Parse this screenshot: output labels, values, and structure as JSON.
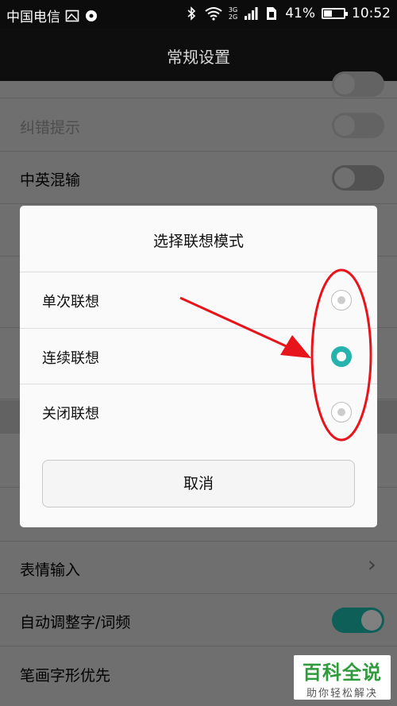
{
  "status_bar": {
    "carrier": "中国电信",
    "network_3g": "3G",
    "network_2g": "2G",
    "battery_pct": "41%",
    "battery_level": 0.41,
    "time": "10:52"
  },
  "header": {
    "title": "常规设置"
  },
  "settings": {
    "spell_hint": "纠错提示",
    "cn_en_mix": "中英混输",
    "emoji_input": "表情输入",
    "auto_adjust": "自动调整字/词频",
    "stroke_priority": "笔画字形优先"
  },
  "dialog": {
    "title": "选择联想模式",
    "options": [
      {
        "label": "单次联想",
        "selected": false
      },
      {
        "label": "连续联想",
        "selected": true
      },
      {
        "label": "关闭联想",
        "selected": false
      }
    ],
    "cancel_label": "取消"
  },
  "colors": {
    "accent": "#26b3ad",
    "annotation": "#e8141c"
  },
  "watermark": {
    "title": "百科全说",
    "subtitle": "助你轻松解决"
  }
}
